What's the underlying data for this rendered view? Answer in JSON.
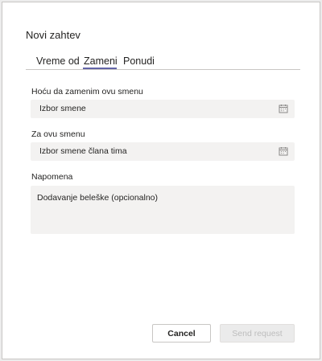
{
  "dialog": {
    "title": "Novi zahtev"
  },
  "tabs": [
    {
      "label": "Vreme od"
    },
    {
      "label": "Zameni"
    },
    {
      "label": "Ponudi"
    }
  ],
  "selected_tab": "Zameni",
  "form": {
    "my_shift_label": "Hoću da zamenim ovu smenu",
    "my_shift_placeholder": "Izbor smene",
    "other_shift_label": "Za ovu smenu",
    "other_shift_placeholder": "Izbor smene člana tima",
    "note_label": "Napomena",
    "note_placeholder": "Dodavanje beleške (opcionalno)"
  },
  "buttons": {
    "cancel": "Cancel",
    "send": "Send request"
  },
  "colors": {
    "accent": "#6264a7",
    "field_bg": "#f3f2f1",
    "border": "#c8c6c4"
  }
}
